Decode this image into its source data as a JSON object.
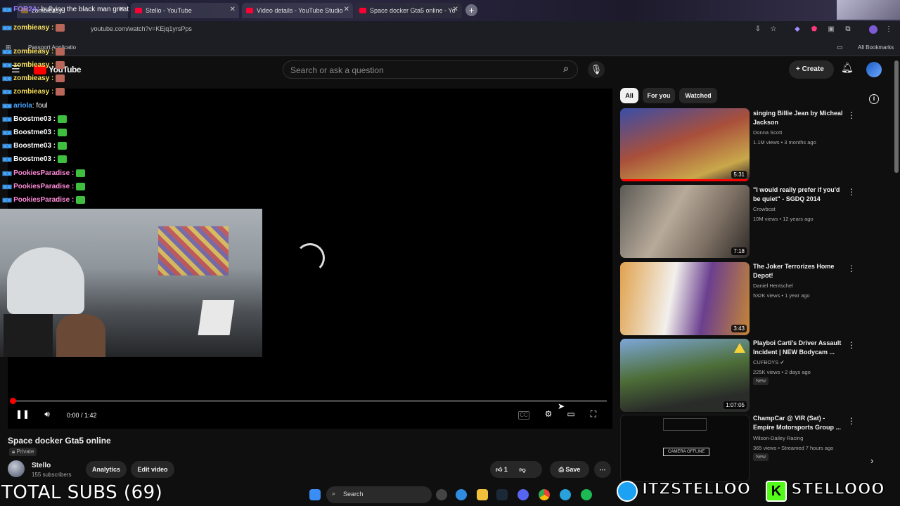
{
  "browser": {
    "tabs": [
      {
        "label": "zombieasy :"
      },
      {
        "label": "Stello - YouTube"
      },
      {
        "label": "Video details - YouTube Studio"
      },
      {
        "label": "Space docker Gta5 online - Yo"
      }
    ],
    "url": "youtube.com/watch?v=KEjq1yrsPps",
    "bookmarks": {
      "passport": "Passport Applicatio",
      "all": "All Bookmarks"
    }
  },
  "youtube": {
    "logo": "YouTube",
    "search_placeholder": "Search or ask a question",
    "create_label": "Create",
    "chips": [
      "All",
      "For you",
      "Watched"
    ],
    "player": {
      "time": "0:00 / 1:42",
      "progress_fraction": 0.0
    },
    "video": {
      "title": "Space docker Gta5 online",
      "privacy": "Private",
      "channel": "Stello",
      "subscribers": "155 subscribers",
      "analytics_label": "Analytics",
      "edit_label": "Edit video",
      "like_count": "1",
      "save_label": "Save"
    },
    "recommendations": [
      {
        "title": "singing Billie Jean by Micheal Jackson",
        "channel": "Donna Scott",
        "meta": "1.1M views • 3 months ago",
        "duration": "5:31",
        "new": ""
      },
      {
        "title": "\"I would really prefer if you'd be quiet\" - SGDQ 2014",
        "channel": "Crowbcat",
        "meta": "10M views • 12 years ago",
        "duration": "7:18",
        "new": ""
      },
      {
        "title": "The Joker Terrorizes Home Depot!",
        "channel": "Daniel Hentschel",
        "meta": "532K views • 1 year ago",
        "duration": "3:43",
        "new": ""
      },
      {
        "title": "Playboi Carti's Driver Assault Incident | NEW Bodycam ...",
        "channel": "CUFBOYS",
        "meta": "225K views • 2 days ago",
        "duration": "1:07:05",
        "new": "New"
      },
      {
        "title": "ChampCar @ VIR (Sat) - Empire Motorsports Group ...",
        "channel": "Wilson-Dailey Racing",
        "meta": "365 views • Streamed 7 hours ago",
        "duration": "",
        "new": "New",
        "thumb_text": "CAMERA OFFLINE"
      }
    ]
  },
  "stream_overlay": {
    "chat": [
      {
        "user": "FOR2A",
        "msg": ": bullying the black man great",
        "color": "#9b7bff"
      },
      {
        "user": "zombieasy :",
        "msg": "",
        "color": "#f6e05e"
      },
      {
        "user": "zombieasy :",
        "msg": "",
        "color": "#f6e05e"
      },
      {
        "user": "zombieasy :",
        "msg": "",
        "color": "#f6e05e"
      },
      {
        "user": "zombieasy :",
        "msg": "",
        "color": "#f6e05e"
      },
      {
        "user": "zombieasy :",
        "msg": "",
        "color": "#f6e05e"
      },
      {
        "user": "ariola",
        "msg": ": foul",
        "color": "#47a8ff"
      },
      {
        "user": "Boostme03 :",
        "msg": "",
        "color": "#ffffff"
      },
      {
        "user": "Boostme03 :",
        "msg": "",
        "color": "#ffffff"
      },
      {
        "user": "Boostme03 :",
        "msg": "",
        "color": "#ffffff"
      },
      {
        "user": "Boostme03 :",
        "msg": "",
        "color": "#ffffff"
      },
      {
        "user": "PookiesParadise :",
        "msg": "",
        "color": "#ff8ad8"
      },
      {
        "user": "PookiesParadise :",
        "msg": "",
        "color": "#ff8ad8"
      },
      {
        "user": "PookiesParadise :",
        "msg": "",
        "color": "#ff8ad8"
      }
    ],
    "total_subs": "TOTAL SUBS (69)",
    "banner": {
      "twitter": "ITZSTELLOO",
      "kick": "STELLOOO"
    }
  },
  "taskbar": {
    "search": "Search"
  },
  "colors": {
    "accent": "#ff0000",
    "bg": "#0f0f0f",
    "chip": "#272727"
  }
}
